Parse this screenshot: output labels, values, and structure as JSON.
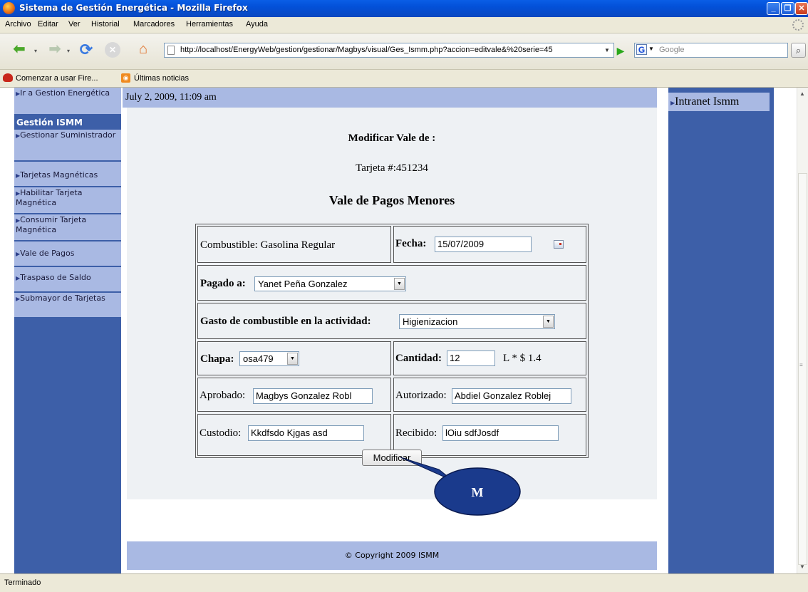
{
  "window": {
    "title": "Sistema de Gestión Energética - Mozilla Firefox"
  },
  "menu": [
    "Archivo",
    "Editar",
    "Ver",
    "Historial",
    "Marcadores",
    "Herramientas",
    "Ayuda"
  ],
  "toolbar": {
    "url": "http://localhost/EnergyWeb/gestion/gestionar/Magbys/visual/Ges_Ismm.php?accion=editvale&%20serie=45",
    "search_placeholder": "Google",
    "search_engine_letter": "G"
  },
  "bookmarks": [
    "Comenzar a usar Fire...",
    "Últimas noticias"
  ],
  "sidebar": {
    "top_item": "Ir a Gestion Energética",
    "heading": "Gestión ISMM",
    "items": [
      "Gestionar Suministrador",
      "Tarjetas Magnéticas",
      "Habilitar Tarjeta Magnética",
      "Consumir Tarjeta Magnética",
      "Vale de Pagos",
      "Traspaso de Saldo",
      "Submayor de Tarjetas"
    ]
  },
  "right_sidebar": {
    "link": "Intranet Ismm"
  },
  "page": {
    "datetime": "July 2, 2009, 11:09 am",
    "heading": "Modificar Vale de :",
    "card": "Tarjeta #:451234",
    "form_title": "Vale de Pagos Menores"
  },
  "form": {
    "combustible_label": "Combustible: Gasolina Regular",
    "fecha_label": "Fecha:",
    "fecha_value": "15/07/2009",
    "pagado_label": "Pagado a:",
    "pagado_value": "Yanet Peña Gonzalez",
    "gasto_label": "Gasto de combustible en la actividad:",
    "gasto_value": "Higienizacion",
    "chapa_label": "Chapa:",
    "chapa_value": "osa479",
    "cantidad_label": "Cantidad:",
    "cantidad_value": "12",
    "cantidad_suffix": "L * $ 1.4",
    "aprobado_label": "Aprobado:",
    "aprobado_value": "Magbys Gonzalez Robl",
    "autorizado_label": "Autorizado:",
    "autorizado_value": "Abdiel Gonzalez Roblej",
    "custodio_label": "Custodio:",
    "custodio_value": "Kkdfsdo Kjgas asd",
    "recibido_label": "Recibido:",
    "recibido_value": "lOiu sdfJosdf",
    "submit_label": "Modificar"
  },
  "callout": {
    "label": "M",
    "fill": "#1a3a8c"
  },
  "footer": {
    "copyright": "© Copyright 2009 ISMM"
  },
  "status": {
    "text": "Terminado"
  },
  "colors": {
    "nav_dark": "#3d5fa8",
    "nav_light": "#a9b9e3",
    "form_bg": "#eef1f4"
  }
}
